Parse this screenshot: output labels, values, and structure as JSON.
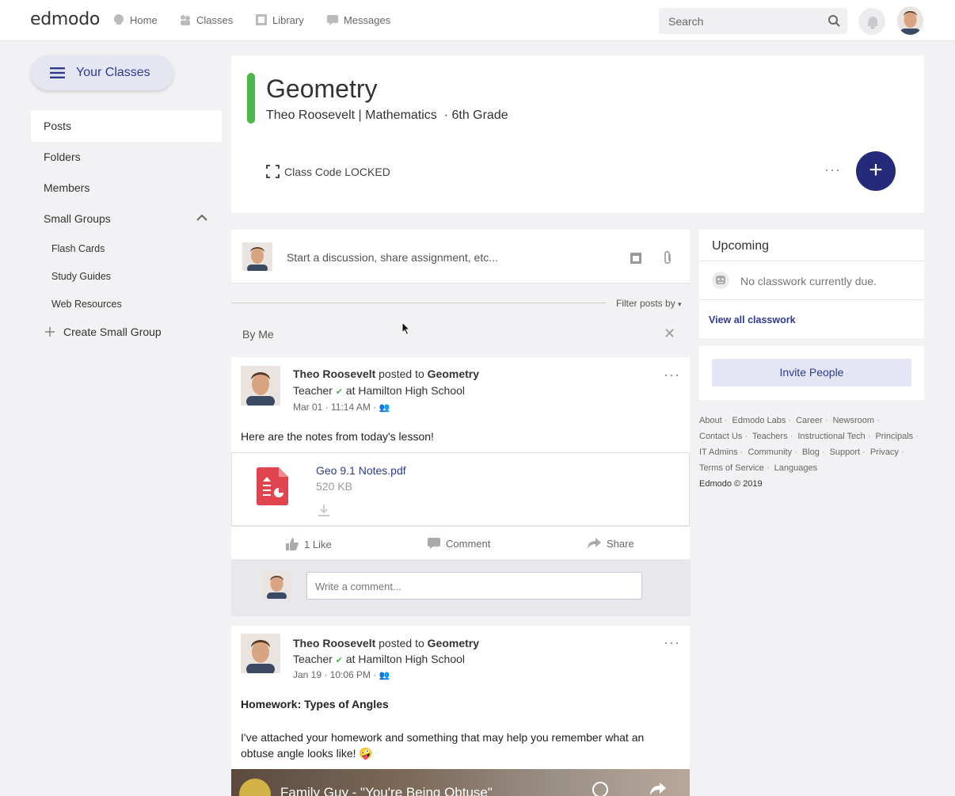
{
  "topbar": {
    "logo": "edmodo",
    "nav": [
      {
        "label": "Home",
        "icon": "home-icon"
      },
      {
        "label": "Classes",
        "icon": "classes-icon"
      },
      {
        "label": "Library",
        "icon": "library-icon"
      },
      {
        "label": "Messages",
        "icon": "messages-icon"
      }
    ],
    "search_placeholder": "Search"
  },
  "sidebar": {
    "your_classes": "Your Classes",
    "items": [
      "Posts",
      "Folders",
      "Members",
      "Small Groups"
    ],
    "sub_items": [
      "Flash Cards",
      "Study Guides",
      "Web Resources"
    ],
    "create_group": "Create Small Group"
  },
  "class_header": {
    "title": "Geometry",
    "subtitle": "Theo Roosevelt | Mathematics  · 6th Grade",
    "class_code": "Class Code LOCKED",
    "more": "···",
    "add": "+"
  },
  "composer": {
    "placeholder": "Start a discussion, share assignment, etc..."
  },
  "filter": {
    "label": "Filter posts by",
    "active_filter": "By Me",
    "clear": "✕"
  },
  "posts": [
    {
      "author": "Theo Roosevelt",
      "posted_to": "posted to",
      "group": "Geometry",
      "role": "Teacher",
      "school": "at Hamilton High School",
      "date": "Mar 01 · 11:14 AM ·",
      "text": "Here are the notes from today's lesson!",
      "attachment": {
        "name": "Geo 9.1 Notes.pdf",
        "size": "520 KB"
      },
      "actions": {
        "like": "1 Like",
        "comment": "Comment",
        "share": "Share"
      },
      "comment_placeholder": "Write a comment..."
    },
    {
      "author": "Theo Roosevelt",
      "posted_to": "posted to",
      "group": "Geometry",
      "role": "Teacher",
      "school": "at Hamilton High School",
      "date": "Jan 19 · 10:06 PM ·",
      "heading": "Homework: Types of Angles",
      "text": "I've attached your homework and something that may help you remember what an obtuse angle looks like! 🤪",
      "video_title": "Family Guy - \"You're Being Obtuse\""
    }
  ],
  "upcoming": {
    "title": "Upcoming",
    "empty": "No classwork currently due.",
    "view_all": "View all classwork"
  },
  "invite": {
    "label": "Invite People"
  },
  "footer": {
    "lines": [
      [
        "About",
        "Edmodo Labs",
        "Career",
        "Newsroom"
      ],
      [
        "Contact Us",
        "Teachers",
        "Instructional Tech",
        "Principals"
      ],
      [
        "IT Admins",
        "Community",
        "Blog",
        "Support",
        "Privacy"
      ],
      [
        "Terms of Service",
        "Languages"
      ]
    ],
    "copyright": "Edmodo © 2019"
  },
  "colors": {
    "accent": "#252b7a",
    "class_color": "#4bb84a",
    "link": "#2f3c8e",
    "pdf": "#e0454f"
  }
}
